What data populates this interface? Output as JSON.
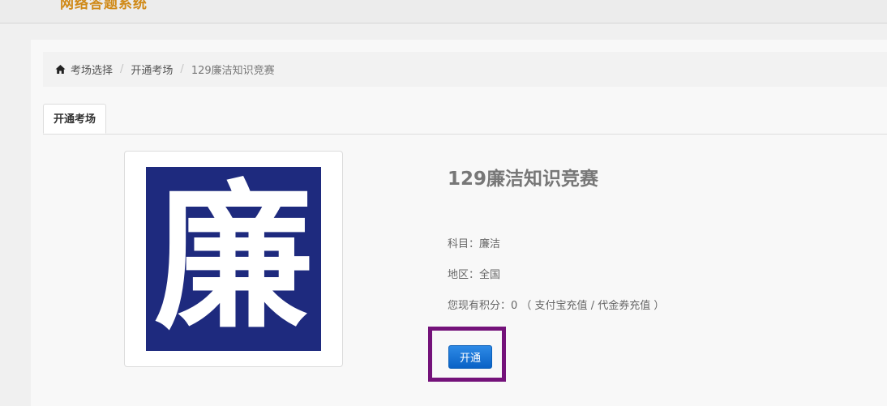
{
  "header": {
    "brand": "网络答题系统"
  },
  "breadcrumb": {
    "items": [
      "考场选择",
      "开通考场",
      "129廉洁知识竞赛"
    ],
    "separator": "/"
  },
  "tabs": [
    {
      "label": "开通考场",
      "active": true
    }
  ],
  "exam": {
    "image_char": "廉",
    "title": "129廉洁知识竞赛",
    "subject": "科目：廉洁",
    "region": "地区：全国",
    "points_prefix": "您现有积分：0 （ ",
    "alipay_recharge": "支付宝充值",
    "divider": " / ",
    "voucher_recharge": "代金券充值",
    "points_suffix": " ）",
    "open_button": "开通"
  },
  "colors": {
    "brand": "#d08a18",
    "image_bg": "#1e2a7e",
    "button": "#0a62c6",
    "highlight": "#74127a"
  }
}
